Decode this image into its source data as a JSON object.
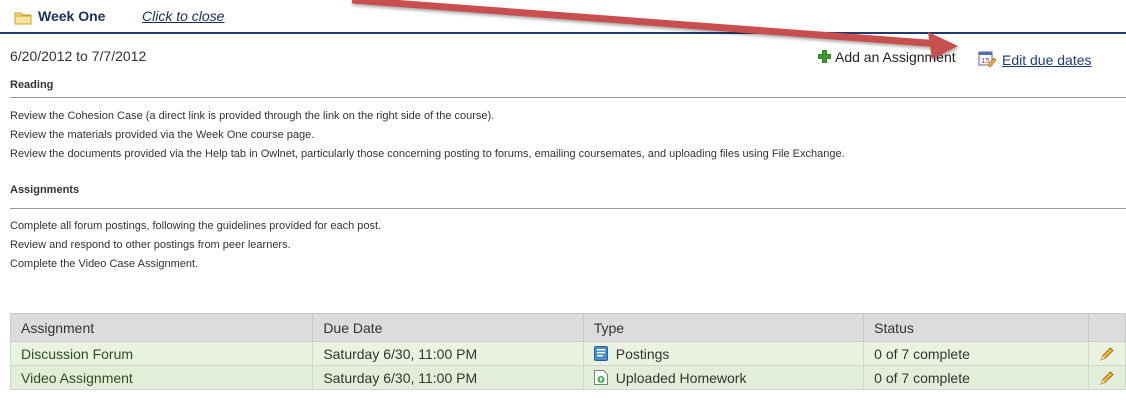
{
  "header": {
    "title": "Week One",
    "close_label": "Click to close"
  },
  "dates": "6/20/2012 to 7/7/2012",
  "actions": {
    "add_assignment": "Add an Assignment",
    "edit_due_dates": "Edit due dates"
  },
  "reading": {
    "heading": "Reading",
    "lines": [
      "Review the Cohesion Case (a direct link is provided through the link on the right side of the course).",
      "Review the materials provided via the Week One course page.",
      "Review the documents provided via the Help tab in Owlnet, particularly those concerning posting to forums, emailing coursemates, and uploading files using File Exchange."
    ]
  },
  "assignments": {
    "heading": "Assignments",
    "lines": [
      "Complete all forum postings, following the guidelines provided for each post.",
      "Review and respond to other postings from peer learners.",
      "Complete the Video Case Assignment."
    ]
  },
  "table": {
    "headers": [
      "Assignment",
      "Due Date",
      "Type",
      "Status",
      ""
    ],
    "rows": [
      {
        "name": "Discussion Forum",
        "due": "Saturday 6/30, 11:00 PM",
        "type": "Postings",
        "type_icon": "postings-icon",
        "status": "0 of 7 complete"
      },
      {
        "name": "Video Assignment",
        "due": "Saturday 6/30, 11:00 PM",
        "type": "Uploaded Homework",
        "type_icon": "uploaded-homework-icon",
        "status": "0 of 7 complete"
      }
    ]
  },
  "colors": {
    "header_rule": "#1f3b6e",
    "annotation_arrow": "#c8504f",
    "row_bg": "#eaf3e0",
    "table_header_bg": "#dcdcdc"
  }
}
